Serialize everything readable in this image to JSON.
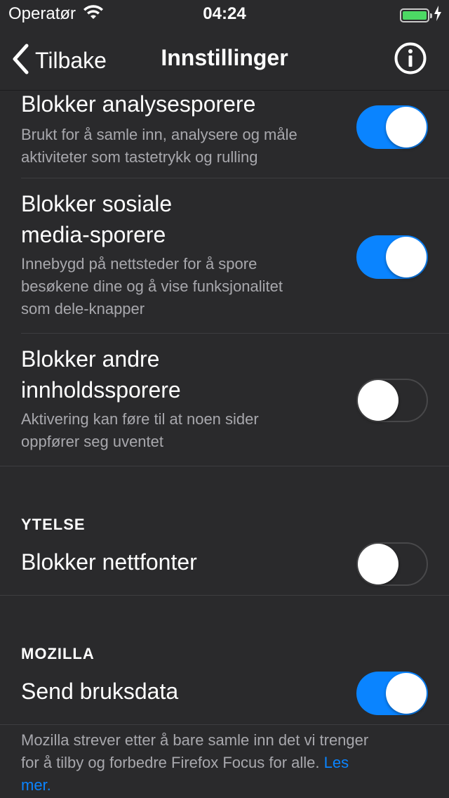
{
  "status_bar": {
    "carrier": "Operatør",
    "time": "04:24",
    "battery_level": 1.0,
    "battery_color": "#4cd964",
    "icons": [
      "wifi-icon",
      "battery-icon",
      "charging-bolt-icon"
    ]
  },
  "nav": {
    "back_label": "Tilbake",
    "title": "Innstillinger",
    "info_icon": "info-icon"
  },
  "rows": [
    {
      "title": "Blokker analysesporere",
      "desc_lines": [
        "Brukt for å samle inn, analysere og måle",
        "aktiviteter som tastetrykk og rulling"
      ],
      "enabled": true
    },
    {
      "title_lines": [
        "Blokker sosiale",
        "media-sporere"
      ],
      "desc_lines": [
        "Innebygd på nettsteder for å spore",
        "besøkene dine og å vise funksjonalitet",
        "som dele-knapper"
      ],
      "enabled": true
    },
    {
      "title_lines": [
        "Blokker andre",
        "innholdssporere"
      ],
      "desc_lines": [
        "Aktivering kan føre til at noen sider",
        "oppfører seg uventet"
      ],
      "enabled": false
    }
  ],
  "performance": {
    "header": "YTELSE",
    "webfonts": {
      "title": "Blokker nettfonter",
      "enabled": false
    }
  },
  "mozilla": {
    "header": "MOZILLA",
    "usage_data": {
      "title": "Send bruksdata",
      "enabled": true
    },
    "footer_lines": [
      "Mozilla strever etter å bare samle inn det vi trenger",
      "for å tilby og forbedre Firefox Focus for alle. "
    ],
    "link_label_1": "Les",
    "link_label_2": "mer."
  },
  "colors": {
    "accent": "#0a84ff",
    "background": "#2a2a2c",
    "secondary_text": "#a8a8ad"
  }
}
